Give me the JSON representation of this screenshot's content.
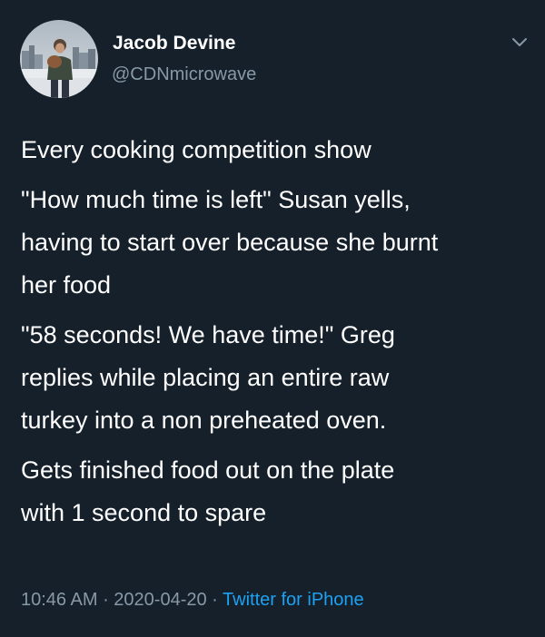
{
  "user": {
    "display_name": "Jacob Devine",
    "handle": "@CDNmicrowave"
  },
  "tweet": {
    "paragraphs": [
      "Every cooking competition show",
      "\"How much time is left\" Susan yells,\nhaving to start over because she burnt\nher food",
      "\"58 seconds! We have time!\" Greg\nreplies while placing an entire raw\nturkey into a non preheated oven.",
      "Gets finished food out on the plate\nwith 1 second to spare"
    ]
  },
  "meta": {
    "time": "10:46 AM",
    "separator": " · ",
    "date": "2020-04-20",
    "source": "Twitter for iPhone"
  },
  "icons": {
    "menu": "chevron-down-icon",
    "avatar": "profile-photo"
  },
  "colors": {
    "background": "#15202b",
    "text": "#ffffff",
    "secondary": "#8899a6",
    "link": "#1da1f2"
  }
}
